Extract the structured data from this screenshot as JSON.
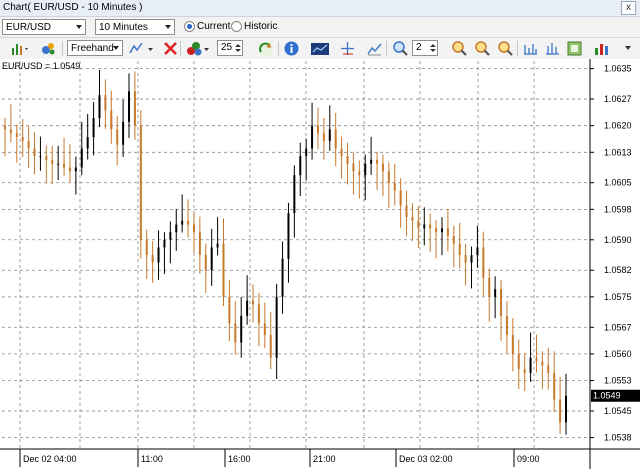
{
  "window": {
    "title": "Chart( EUR/USD - 10 Minutes )",
    "close_glyph": "x"
  },
  "toolbar1": {
    "symbol": "EUR/USD",
    "timeframe": "10 Minutes",
    "mode_current": "Current",
    "mode_historic": "Historic",
    "selected_mode": "Current"
  },
  "toolbar2": {
    "drawing_mode": "Freehand",
    "line_width": "25",
    "zoom_value": "2",
    "icons": [
      "bar-chart-icon",
      "indicators-icon",
      "drawing-tool-icon",
      "delete-icon",
      "color-palette-icon",
      "refresh-icon",
      "info-icon",
      "chart-type-icon",
      "crosshair-icon",
      "trendline-icon",
      "zoom-icon",
      "zoom-in-icon",
      "zoom-out-icon",
      "zoom-fit-icon",
      "scale-icon",
      "template-icon",
      "volume-icon"
    ]
  },
  "chart": {
    "symbol_label": "EUR/USD = 1.0549",
    "current_price": "1.0549",
    "bull_color": "#000000",
    "bear_color": "#c8782a"
  },
  "chart_data": {
    "type": "candlestick",
    "title": "",
    "y_ticks": [
      "1.0635",
      "1.0627",
      "1.0620",
      "1.0613",
      "1.0605",
      "1.0598",
      "1.0590",
      "1.0582",
      "1.0575",
      "1.0567",
      "1.0560",
      "1.0553",
      "1.0545",
      "1.0538"
    ],
    "ylim": [
      1.0535,
      1.0637
    ],
    "x_ticks": [
      "Dec 02 04:00",
      "11:00",
      "16:00",
      "21:00",
      "Dec 03 02:00",
      "09:00"
    ],
    "last_price": 1.0549,
    "close_series": [
      1.0619,
      1.0618,
      1.0617,
      1.0616,
      1.0614,
      1.0612,
      1.0612,
      1.0611,
      1.061,
      1.061,
      1.0609,
      1.0608,
      1.0609,
      1.0614,
      1.0617,
      1.0622,
      1.0628,
      1.0624,
      1.0619,
      1.0615,
      1.0621,
      1.0629,
      1.062,
      1.059,
      1.0586,
      1.0584,
      1.0588,
      1.059,
      1.0592,
      1.0594,
      1.0595,
      1.0594,
      1.0592,
      1.0586,
      1.0582,
      1.0588,
      1.0589,
      1.0575,
      1.0568,
      1.0563,
      1.057,
      1.0574,
      1.0573,
      1.0568,
      1.0565,
      1.0559,
      1.0575,
      1.0585,
      1.0597,
      1.0607,
      1.0612,
      1.0614,
      1.062,
      1.0618,
      1.0616,
      1.0619,
      1.0614,
      1.0612,
      1.061,
      1.0608,
      1.0607,
      1.061,
      1.0611,
      1.061,
      1.0608,
      1.0605,
      1.0603,
      1.0599,
      1.0596,
      1.0595,
      1.0593,
      1.0594,
      1.0593,
      1.0592,
      1.0593,
      1.0591,
      1.0589,
      1.0586,
      1.0584,
      1.0586,
      1.0588,
      1.058,
      1.0575,
      1.0577,
      1.057,
      1.0565,
      1.056,
      1.0556,
      1.0555,
      1.0559,
      1.0558,
      1.0557,
      1.0555,
      1.0548,
      1.0542,
      1.0549
    ]
  }
}
